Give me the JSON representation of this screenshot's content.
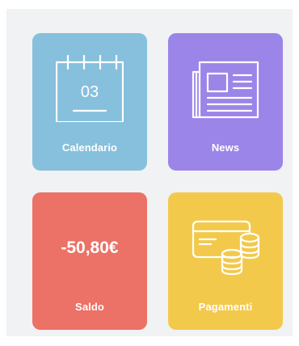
{
  "colors": {
    "calendario": "#86c0dc",
    "news": "#9b85e8",
    "saldo": "#ec7166",
    "pagamenti": "#f3c94c"
  },
  "tiles": [
    {
      "label": "Calendario",
      "icon": "calendar-icon",
      "day": "03"
    },
    {
      "label": "News",
      "icon": "newspaper-icon"
    },
    {
      "label": "Saldo",
      "value": "-50,80€"
    },
    {
      "label": "Pagamenti",
      "icon": "card-coins-icon"
    }
  ]
}
